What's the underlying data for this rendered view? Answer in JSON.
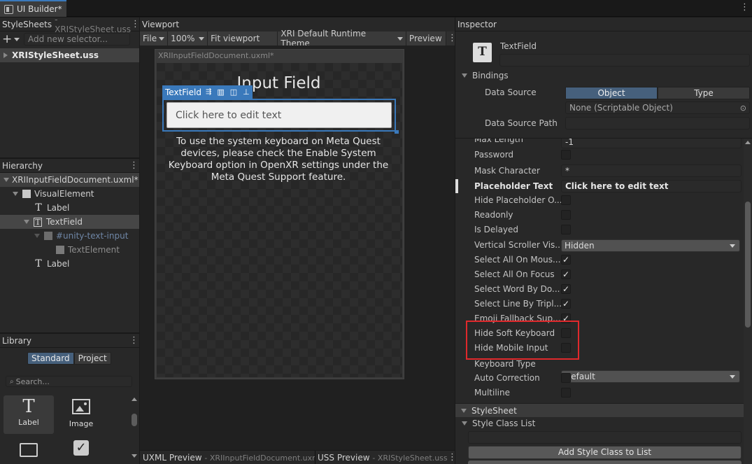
{
  "window": {
    "tab_title": "UI Builder*"
  },
  "stylesheets": {
    "header": "StyleSheets",
    "header_file": "- XRIStyleSheet.uss",
    "add_selector_placeholder": "Add new selector...",
    "items": [
      "XRIStyleSheet.uss"
    ]
  },
  "hierarchy": {
    "header": "Hierarchy",
    "document": "XRIInputFieldDocument.uxml*",
    "items": [
      "VisualElement",
      "Label",
      "TextField",
      "#unity-text-input",
      "TextElement",
      "Label"
    ]
  },
  "library": {
    "header": "Library",
    "tabs": [
      "Standard",
      "Project"
    ],
    "search_placeholder": "Search...",
    "items": [
      "Label",
      "Image"
    ]
  },
  "viewport": {
    "header": "Viewport",
    "file_menu": "File",
    "zoom": "100%",
    "fit_button": "Fit viewport",
    "theme": "XRI Default Runtime Theme",
    "preview_button": "Preview",
    "document_title": "XRIInputFieldDocument.uxml*",
    "canvas_title": "Input Field",
    "selected_label": "TextField",
    "text_field_value": "Click here to edit text",
    "description": "To use the system keyboard on Meta Quest devices, please check the Enable System Keyboard option in OpenXR settings under the Meta Quest Support feature.",
    "uxml_preview_label": "UXML Preview",
    "uxml_preview_file": "- XRIInputFieldDocument.uxml",
    "uss_preview_label": "USS Preview",
    "uss_preview_file": "- XRIStyleSheet.uss"
  },
  "inspector": {
    "header": "Inspector",
    "element_type": "TextField",
    "bindings_label": "Bindings",
    "data_source_label": "Data Source",
    "data_source_tabs": [
      "Object",
      "Type"
    ],
    "data_source_value": "None (Scriptable Object)",
    "data_source_path_label": "Data Source Path",
    "max_length_label": "Max Length",
    "max_length_value": "-1",
    "password_label": "Password",
    "mask_character_label": "Mask Character",
    "mask_character_value": "*",
    "placeholder_label": "Placeholder Text",
    "placeholder_value": "Click here to edit text",
    "hide_placeholder_label": "Hide Placeholder O...",
    "readonly_label": "Readonly",
    "is_delayed_label": "Is Delayed",
    "vertical_scroller_label": "Vertical Scroller Vis...",
    "vertical_scroller_value": "Hidden",
    "select_all_mouse_label": "Select All On Mous...",
    "select_all_focus_label": "Select All On Focus",
    "select_word_label": "Select Word By Do...",
    "select_line_label": "Select Line By Tripl...",
    "emoji_fallback_label": "Emoji Fallback Sup...",
    "hide_soft_keyboard_label": "Hide Soft Keyboard",
    "hide_mobile_input_label": "Hide Mobile Input",
    "keyboard_type_label": "Keyboard Type",
    "keyboard_type_value": "Default",
    "auto_correction_label": "Auto Correction",
    "multiline_label": "Multiline",
    "stylesheet_section": "StyleSheet",
    "style_class_list_label": "Style Class List",
    "add_style_class_button": "Add Style Class to List"
  },
  "checks": {
    "password": false,
    "hide_placeholder": false,
    "readonly": false,
    "is_delayed": false,
    "select_all_mouse": true,
    "select_all_focus": true,
    "select_word": true,
    "select_line": true,
    "emoji_fallback": true,
    "hide_soft_keyboard": false,
    "hide_mobile_input": false,
    "auto_correction": false,
    "multiline": false
  },
  "colors": {
    "accent": "#3a79bb",
    "highlight_box": "#e0292c",
    "selected_tab": "#46607c"
  }
}
